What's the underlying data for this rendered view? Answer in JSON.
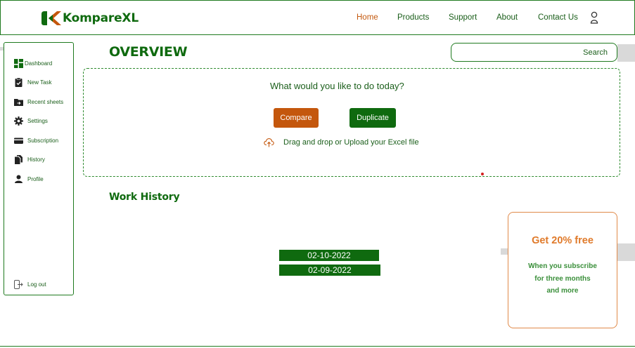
{
  "brand": {
    "name": "KompareXL",
    "colors": {
      "primary": "#0f6a0f",
      "accent": "#c4570d"
    }
  },
  "nav": {
    "links": [
      {
        "label": "Home",
        "active": true
      },
      {
        "label": "Products"
      },
      {
        "label": "Support"
      },
      {
        "label": "About"
      },
      {
        "label": "Contact Us"
      }
    ],
    "user_icon": "user-icon"
  },
  "sidebar": {
    "items": [
      {
        "label": "Dashboard",
        "icon": "dashboard-icon",
        "active": true
      },
      {
        "label": "New Task",
        "icon": "checklist-icon"
      },
      {
        "label": "Recent sheets",
        "icon": "folder-icon"
      },
      {
        "label": "Settings",
        "icon": "gear-icon"
      },
      {
        "label": "Subscription",
        "icon": "credit-card-icon"
      },
      {
        "label": "History",
        "icon": "documents-icon"
      },
      {
        "label": "Profile",
        "icon": "person-icon"
      }
    ],
    "logout": {
      "label": "Log out",
      "icon": "logout-icon"
    }
  },
  "main": {
    "title": "OVERVIEW",
    "search": {
      "label": "Search"
    },
    "upload_panel": {
      "prompt": "What would you like to do today?",
      "compare_label": "Compare",
      "duplicate_label": "Duplicate",
      "upload_text": "Drag and drop or Upload your Excel file",
      "upload_icon": "upload-cloud-icon"
    },
    "work_history": {
      "title": "Work History",
      "entries": [
        "02-10-2022",
        "02-09-2022"
      ]
    }
  },
  "promo": {
    "title": "Get 20% free",
    "lines": [
      "When you subscribe",
      "for three months",
      "and more"
    ]
  }
}
